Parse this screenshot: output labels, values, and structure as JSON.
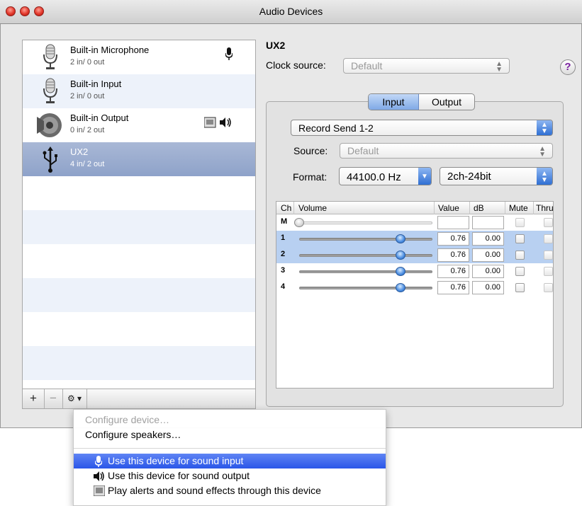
{
  "window": {
    "title": "Audio Devices"
  },
  "devices": [
    {
      "name": "Built-in Microphone",
      "io": "2 in/ 0 out",
      "icon": "microphone-icon",
      "badge": "mic-badge-icon"
    },
    {
      "name": "Built-in Input",
      "io": "2 in/ 0 out",
      "icon": "microphone-icon"
    },
    {
      "name": "Built-in Output",
      "io": "0 in/ 2 out",
      "icon": "speaker-icon",
      "badge": "alerts-and-speaker-badge-icon"
    },
    {
      "name": "UX2",
      "io": "4 in/ 2 out",
      "icon": "usb-icon",
      "selected": true
    }
  ],
  "list_buttons": {
    "add": "+",
    "remove": "−",
    "action": "⚙ ▾"
  },
  "detail": {
    "device_title": "UX2",
    "clock_label": "Clock source:",
    "clock_value": "Default",
    "help": "?",
    "tabs": [
      "Input",
      "Output"
    ],
    "active_tab": "Input",
    "stream": "Record Send 1-2",
    "source_label": "Source:",
    "source_value": "Default",
    "format_label": "Format:",
    "format_rate": "44100.0 Hz",
    "format_bits": "2ch-24bit"
  },
  "table": {
    "headers": {
      "ch": "Ch",
      "volume": "Volume",
      "value": "Value",
      "db": "dB",
      "mute": "Mute",
      "thru": "Thru"
    },
    "rows": [
      {
        "ch": "M",
        "volume": 0,
        "value": "",
        "db": "",
        "mute": false,
        "thru": false
      },
      {
        "ch": "1",
        "volume": 0.76,
        "value": "0.76",
        "db": "0.00",
        "mute": false,
        "thru": false
      },
      {
        "ch": "2",
        "volume": 0.76,
        "value": "0.76",
        "db": "0.00",
        "mute": false,
        "thru": false
      },
      {
        "ch": "3",
        "volume": 0.76,
        "value": "0.76",
        "db": "0.00",
        "mute": false,
        "thru": false
      },
      {
        "ch": "4",
        "volume": 0.76,
        "value": "0.76",
        "db": "0.00",
        "mute": false,
        "thru": false
      }
    ]
  },
  "menu": {
    "configure_device": "Configure device…",
    "configure_speakers": "Configure speakers…",
    "use_input": "Use this device for sound input",
    "use_output": "Use this device for sound output",
    "play_alerts": "Play alerts and sound effects through this device"
  },
  "colors": {
    "selection": "#8ea2c9",
    "menu_highlight": "#2a56e8",
    "accent": "#2f6fd3"
  }
}
